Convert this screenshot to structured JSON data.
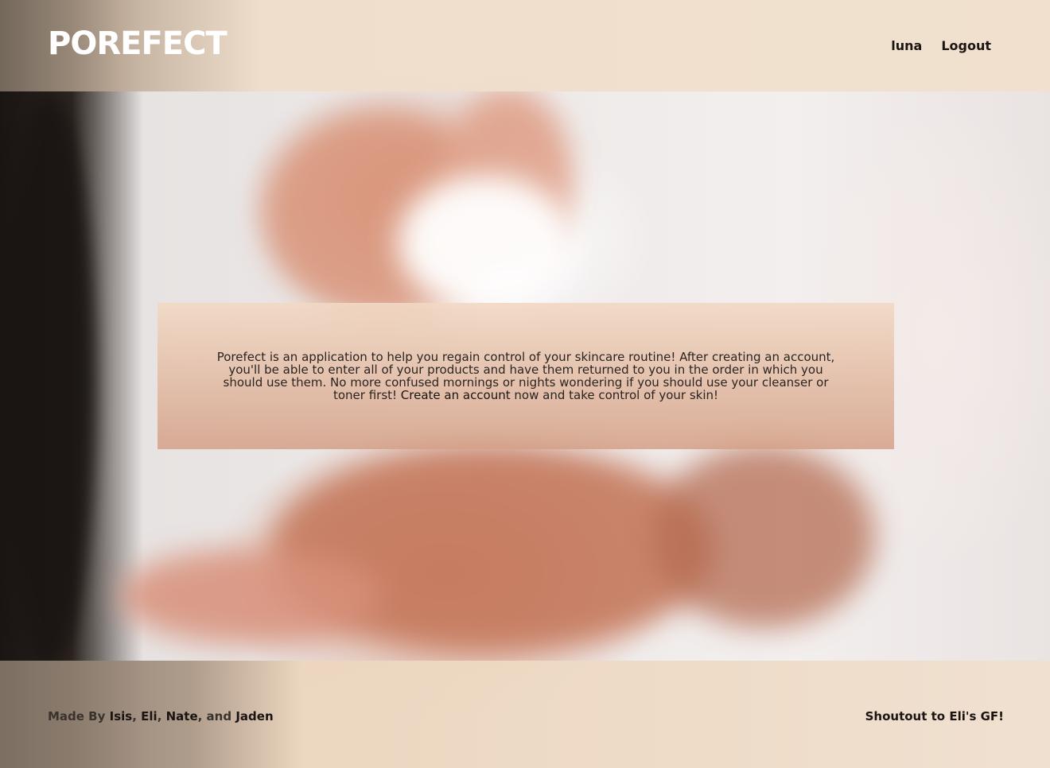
{
  "header": {
    "logo": "POREFECT",
    "nav": {
      "user_label": "luna",
      "logout_label": "Logout"
    }
  },
  "about": {
    "text_before_link": "Porefect is an application to help you regain control of your skincare routine! After creating an account, you'll be able to enter all of your products and have them returned to you in the order in which you should use them. No more confused mornings or nights wondering if you should use your cleanser or toner first! ",
    "link_label": "Create an account",
    "text_after_link": " now and take control of your skin!"
  },
  "footer": {
    "made_by_label": "Made By",
    "authors": [
      "Isis",
      "Eli",
      "Nate",
      "Jaden"
    ],
    "separator_1": ", ",
    "separator_2": ", ",
    "separator_3": ", and ",
    "shoutout": "Shoutout to Eli's GF!"
  },
  "colors": {
    "header_bg": "#F1E0CD",
    "footer_bg": "#F0E0CF",
    "text_dark": "#1B1613",
    "logo": "#FFFFFF"
  }
}
